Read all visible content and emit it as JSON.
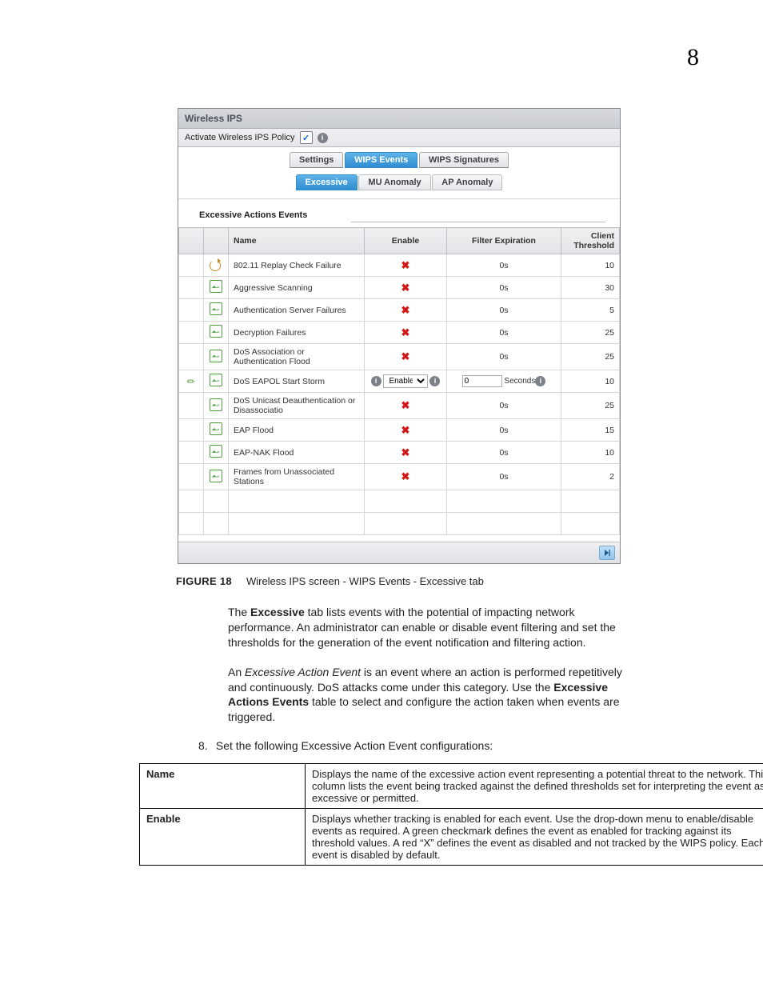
{
  "chapter": "8",
  "shot": {
    "title": "Wireless IPS",
    "activate_label": "Activate Wireless IPS Policy",
    "activate_checked": true,
    "tabs": {
      "settings": "Settings",
      "wips_events": "WIPS Events",
      "wips_sigs": "WIPS Signatures"
    },
    "subtabs": {
      "excessive": "Excessive",
      "mu": "MU Anomaly",
      "ap": "AP Anomaly"
    },
    "section": "Excessive Actions Events",
    "cols": {
      "name": "Name",
      "enable": "Enable",
      "filter": "Filter Expiration",
      "client": "Client Threshold"
    },
    "rows": [
      {
        "name": "802.11 Replay Check Failure",
        "enable": "x",
        "filter": "0s",
        "client": "10",
        "icon": "replay"
      },
      {
        "name": "Aggressive Scanning",
        "enable": "x",
        "filter": "0s",
        "client": "30",
        "icon": "ev"
      },
      {
        "name": "Authentication Server Failures",
        "enable": "x",
        "filter": "0s",
        "client": "5",
        "icon": "ev"
      },
      {
        "name": "Decryption Failures",
        "enable": "x",
        "filter": "0s",
        "client": "25",
        "icon": "ev"
      },
      {
        "name": "DoS Association or Authentication Flood",
        "enable": "x",
        "filter": "0s",
        "client": "25",
        "icon": "ev"
      },
      {
        "name": "DoS EAPOL Start Storm",
        "enable": "edit",
        "enable_val": "Enabled",
        "filter_val": "0",
        "filter_unit": "Seconds",
        "client": "10",
        "icon": "ev"
      },
      {
        "name": "DoS Unicast Deauthentication or Disassociatio",
        "enable": "x",
        "filter": "0s",
        "client": "25",
        "icon": "ev"
      },
      {
        "name": "EAP Flood",
        "enable": "x",
        "filter": "0s",
        "client": "15",
        "icon": "ev"
      },
      {
        "name": "EAP-NAK Flood",
        "enable": "x",
        "filter": "0s",
        "client": "10",
        "icon": "ev"
      },
      {
        "name": "Frames from Unassociated Stations",
        "enable": "x",
        "filter": "0s",
        "client": "2",
        "icon": "ev"
      }
    ]
  },
  "caption": {
    "label": "FIGURE 18",
    "text": "Wireless IPS screen - WIPS Events - Excessive tab"
  },
  "p1a": "The ",
  "p1b": "Excessive",
  "p1c": " tab lists events with the potential of impacting network performance. An administrator can enable or disable event filtering and set the thresholds for the generation of the event notification and filtering action.",
  "p2a": "An ",
  "p2b": "Excessive Action Event",
  "p2c": " is an event where an action is performed repetitively and continuously. DoS attacks come under this category. Use the ",
  "p2d": "Excessive Actions Events",
  "p2e": " table to select and configure the action taken when events are triggered.",
  "step": {
    "num": "8.",
    "a": "Set the following ",
    "b": "Excessive Action Event",
    "c": " configurations:"
  },
  "desc": [
    {
      "h": "Name",
      "d": "Displays the name of the excessive action event representing a potential threat to the network. This column lists the event being tracked against the defined thresholds set for interpreting the event as excessive or permitted."
    },
    {
      "h": "Enable",
      "d": "Displays whether tracking is enabled for each event. Use the drop-down menu to enable/disable events as required. A green checkmark defines the event as enabled for tracking against its threshold values. A red “X” defines the event as disabled and not tracked by the WIPS policy. Each event is disabled by default."
    }
  ]
}
